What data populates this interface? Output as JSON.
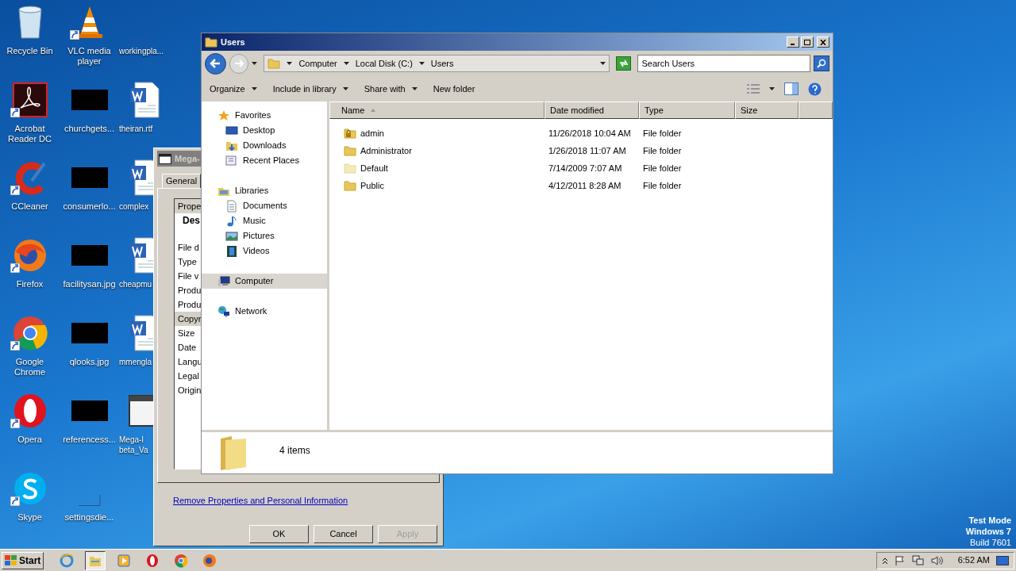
{
  "desktop_icons": [
    {
      "label": "Recycle Bin",
      "kind": "recycle",
      "shortcut": false
    },
    {
      "label": "VLC media player",
      "kind": "vlc",
      "shortcut": true
    },
    {
      "label": "workingpla...",
      "kind": "blank",
      "shortcut": false
    },
    {
      "label": "Acrobat Reader DC",
      "kind": "acrobat",
      "shortcut": true
    },
    {
      "label": "churchgets...",
      "kind": "thumb",
      "shortcut": false
    },
    {
      "label": "theiran.rtf",
      "kind": "word",
      "shortcut": false
    },
    {
      "label": "CCleaner",
      "kind": "ccleaner",
      "shortcut": true
    },
    {
      "label": "consumerlo...",
      "kind": "thumb",
      "shortcut": false
    },
    {
      "label": "complex",
      "kind": "word",
      "shortcut": false
    },
    {
      "label": "Firefox",
      "kind": "firefox",
      "shortcut": true
    },
    {
      "label": "facilitysan.jpg",
      "kind": "thumb",
      "shortcut": false
    },
    {
      "label": "cheapmu",
      "kind": "word",
      "shortcut": false
    },
    {
      "label": "Google Chrome",
      "kind": "chrome",
      "shortcut": true
    },
    {
      "label": "qlooks.jpg",
      "kind": "thumb",
      "shortcut": false
    },
    {
      "label": "mmengla",
      "kind": "word",
      "shortcut": false
    },
    {
      "label": "Opera",
      "kind": "opera",
      "shortcut": true
    },
    {
      "label": "referencess...",
      "kind": "thumb",
      "shortcut": false
    },
    {
      "label": "Mega-I beta_Va",
      "kind": "window",
      "shortcut": false
    },
    {
      "label": "Skype",
      "kind": "skype",
      "shortcut": true
    },
    {
      "label": "settingsdie...",
      "kind": "blank",
      "shortcut": false
    }
  ],
  "properties_dialog": {
    "title": "Mega-",
    "tabs": [
      {
        "label": "General",
        "selected": true
      }
    ],
    "list_header": "Prope",
    "group": "Des",
    "rows": [
      {
        "label": "File d",
        "selected": false
      },
      {
        "label": "Type",
        "selected": false
      },
      {
        "label": "File v",
        "selected": false
      },
      {
        "label": "Produ",
        "selected": false
      },
      {
        "label": "Produ",
        "selected": false
      },
      {
        "label": "Copyr",
        "selected": true
      },
      {
        "label": "Size",
        "selected": false
      },
      {
        "label": "Date",
        "selected": false
      },
      {
        "label": "Langu",
        "selected": false
      },
      {
        "label": "Legal",
        "selected": false
      },
      {
        "label": "Origin",
        "selected": false
      }
    ],
    "link": "Remove Properties and Personal Information",
    "buttons": [
      {
        "label": "OK",
        "disabled": false
      },
      {
        "label": "Cancel",
        "disabled": false
      },
      {
        "label": "Apply",
        "disabled": true
      }
    ]
  },
  "explorer": {
    "title": "Users",
    "breadcrumb": [
      "Computer",
      "Local Disk (C:)",
      "Users"
    ],
    "search": {
      "placeholder": "Search Users"
    },
    "toolbar": [
      {
        "label": "Organize",
        "dropdown": true
      },
      {
        "label": "Include in library",
        "dropdown": true
      },
      {
        "label": "Share with",
        "dropdown": true
      },
      {
        "label": "New folder",
        "dropdown": false
      }
    ],
    "nav": [
      {
        "label": "Favorites",
        "selected": false,
        "children": [
          {
            "label": "Desktop",
            "selected": false
          },
          {
            "label": "Downloads",
            "selected": false
          },
          {
            "label": "Recent Places",
            "selected": false
          }
        ]
      },
      {
        "label": "Libraries",
        "selected": false,
        "children": [
          {
            "label": "Documents",
            "selected": false
          },
          {
            "label": "Music",
            "selected": false
          },
          {
            "label": "Pictures",
            "selected": false
          },
          {
            "label": "Videos",
            "selected": false
          }
        ]
      },
      {
        "label": "Computer",
        "selected": true
      },
      {
        "label": "Network",
        "selected": false
      }
    ],
    "columns": [
      {
        "label": "Name",
        "sorted": true
      },
      {
        "label": "Date modified",
        "sorted": false
      },
      {
        "label": "Type",
        "sorted": false
      },
      {
        "label": "Size",
        "sorted": false
      }
    ],
    "rows": [
      {
        "name": "admin",
        "date": "11/26/2018 10:04 AM",
        "type": "File folder",
        "kind": "locked"
      },
      {
        "name": "Administrator",
        "date": "1/26/2018 11:07 AM",
        "type": "File folder",
        "kind": "folder"
      },
      {
        "name": "Default",
        "date": "7/14/2009 7:07 AM",
        "type": "File folder",
        "kind": "hidden"
      },
      {
        "name": "Public",
        "date": "4/12/2011 8:28 AM",
        "type": "File folder",
        "kind": "folder"
      }
    ],
    "status": "4 items"
  },
  "test_mode": [
    "Test Mode",
    "Windows 7",
    "Build 7601"
  ],
  "taskbar": {
    "start": "Start",
    "apps": [
      {
        "kind": "ie",
        "selected": false
      },
      {
        "kind": "explorer",
        "selected": true
      },
      {
        "kind": "media",
        "selected": false
      },
      {
        "kind": "opera",
        "selected": false
      },
      {
        "kind": "chrome",
        "selected": false
      },
      {
        "kind": "firefox",
        "selected": false
      }
    ],
    "clock": "6:52 AM"
  }
}
